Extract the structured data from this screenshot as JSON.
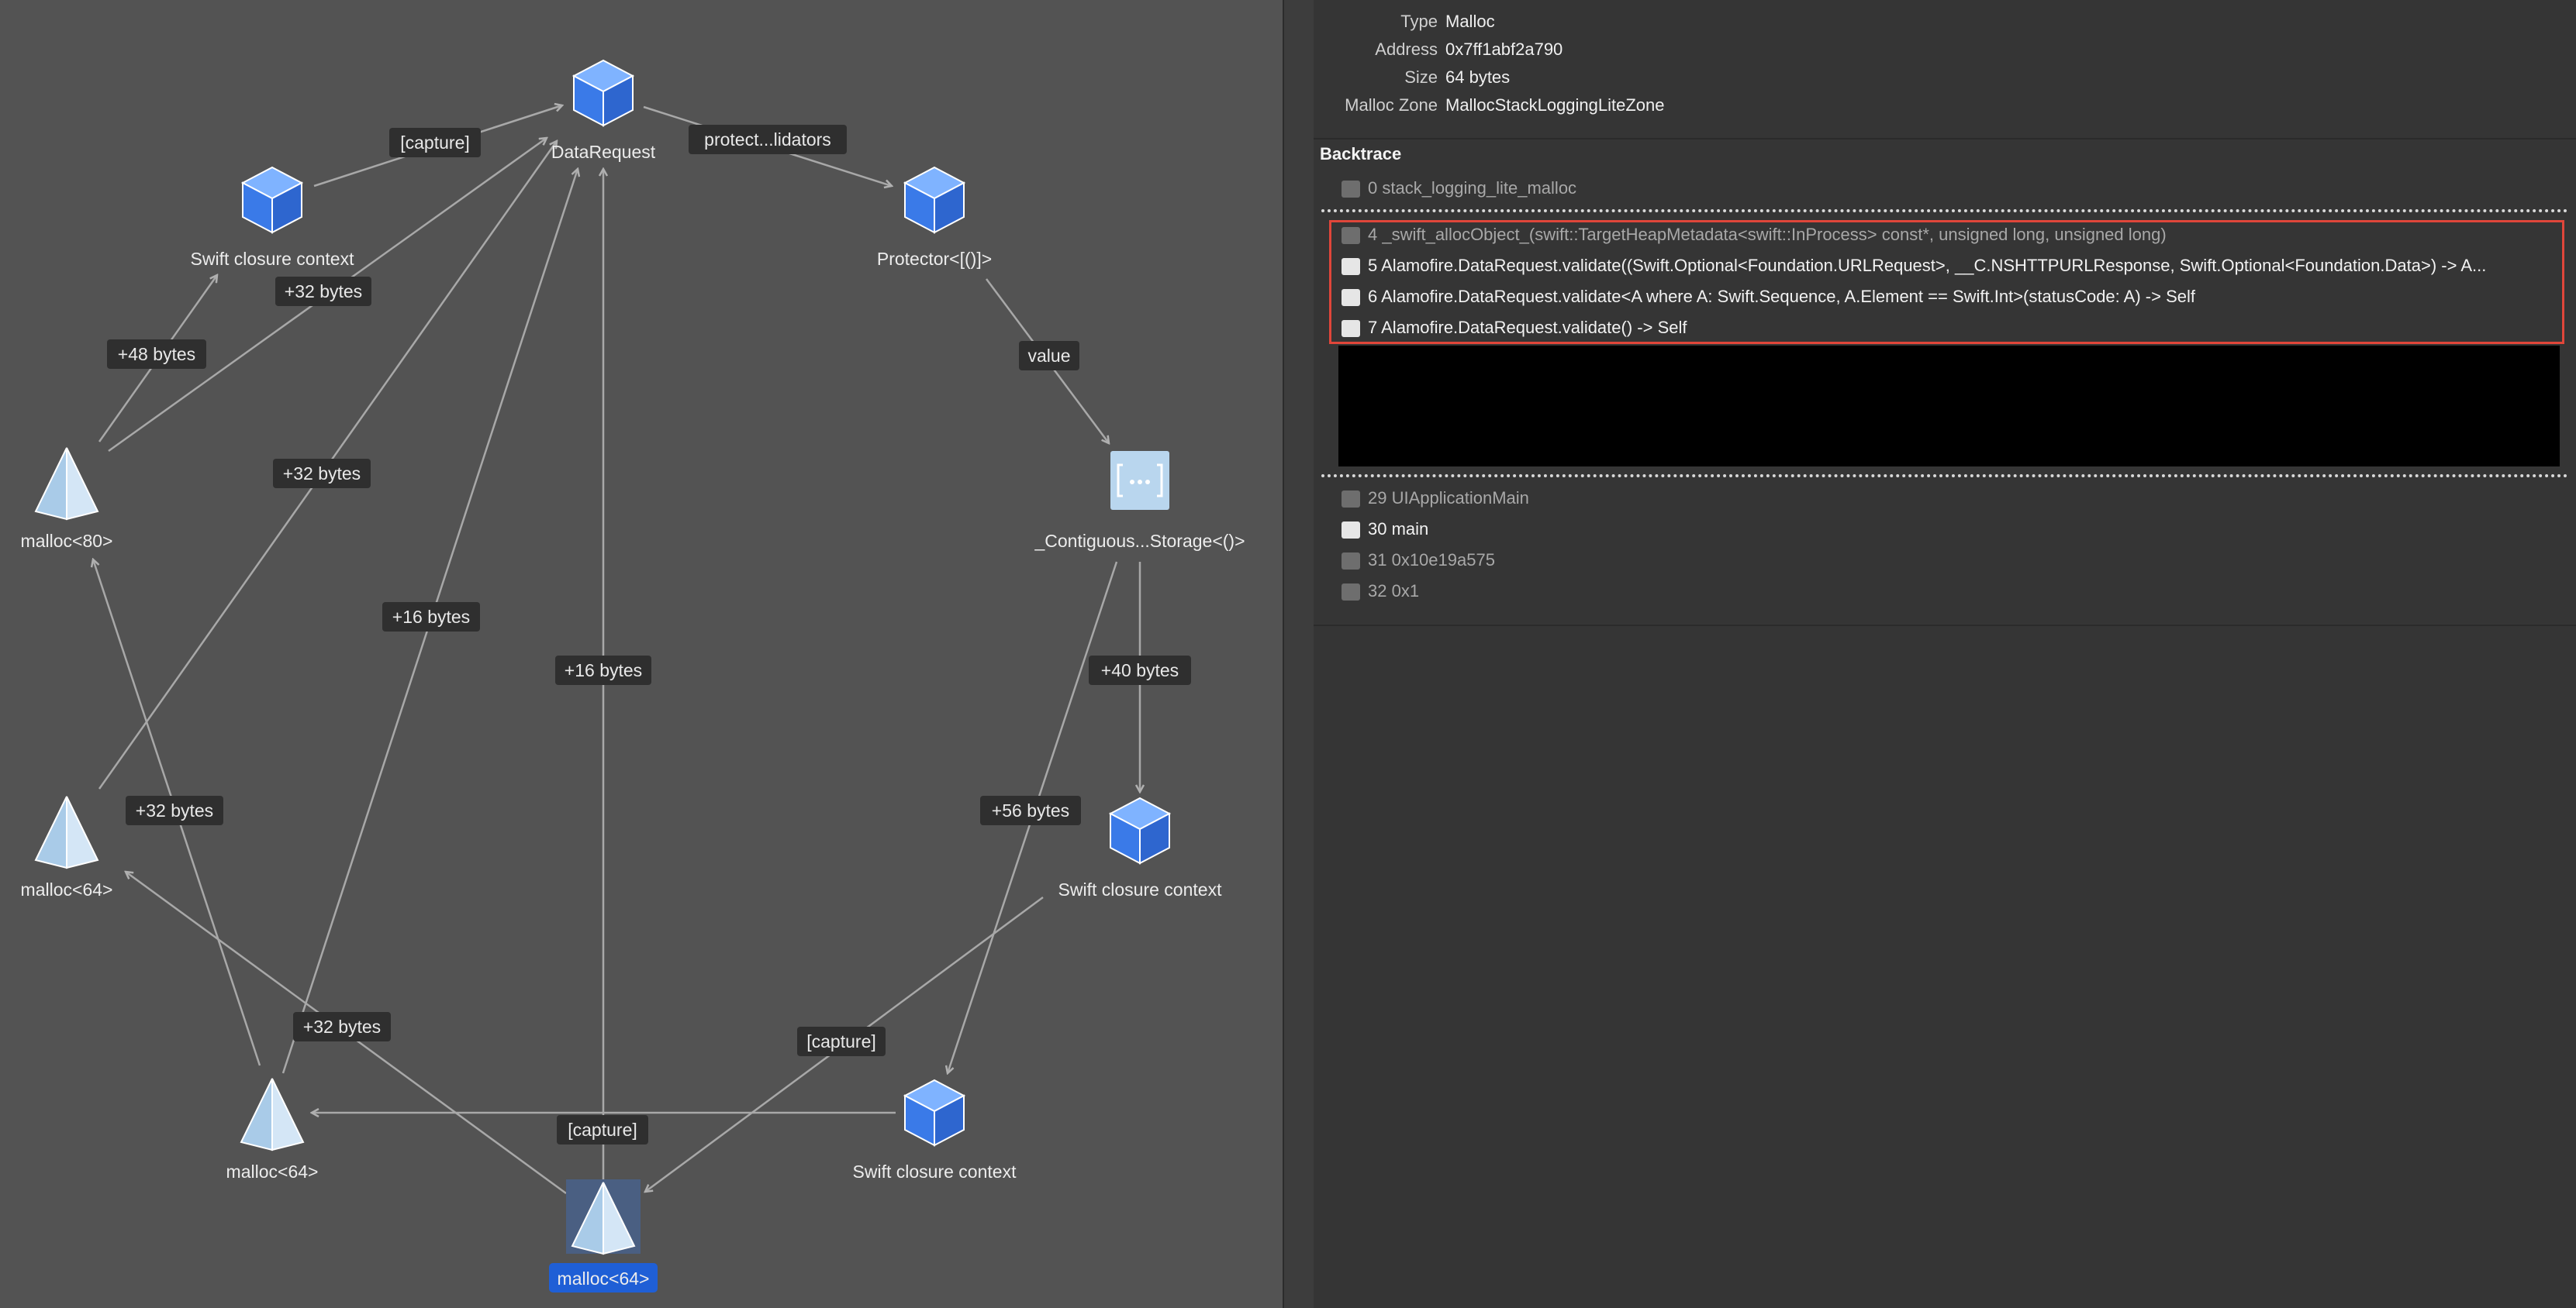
{
  "graph": {
    "nodes": [
      {
        "id": "dr",
        "label": "DataRequest",
        "shape": "cube"
      },
      {
        "id": "scc1",
        "label": "Swift closure context",
        "shape": "cube"
      },
      {
        "id": "prot",
        "label": "Protector<[()]>",
        "shape": "cube"
      },
      {
        "id": "m80",
        "label": "malloc<80>",
        "shape": "pyramid"
      },
      {
        "id": "cont",
        "label": "_Contiguous...Storage<()>",
        "shape": "ellipsis"
      },
      {
        "id": "m64a",
        "label": "malloc<64>",
        "shape": "pyramid"
      },
      {
        "id": "scc2",
        "label": "Swift closure context",
        "shape": "cube"
      },
      {
        "id": "m64b",
        "label": "malloc<64>",
        "shape": "pyramid"
      },
      {
        "id": "scc3",
        "label": "Swift closure context",
        "shape": "cube"
      },
      {
        "id": "m64sel",
        "label": "malloc<64>",
        "shape": "pyramid",
        "selected": true
      }
    ],
    "edge_labels": {
      "capture1": "[capture]",
      "protect": "protect...lidators",
      "b32a": "+32 bytes",
      "b48": "+48 bytes",
      "value": "value",
      "b32b": "+32 bytes",
      "b16a": "+16 bytes",
      "b16b": "+16 bytes",
      "b40": "+40 bytes",
      "b32c": "+32 bytes",
      "b56": "+56 bytes",
      "b32d": "+32 bytes",
      "capture2": "[capture]",
      "capture3": "[capture]"
    },
    "colors": {
      "cube": "#3b82f0",
      "pyramid": "#b9d6ee",
      "selected": "#1f5fd6",
      "edge": "#a8a8a8"
    }
  },
  "details": {
    "rows": [
      {
        "key": "Type",
        "value": "Malloc"
      },
      {
        "key": "Address",
        "value": "0x7ff1abf2a790"
      },
      {
        "key": "Size",
        "value": "64 bytes"
      },
      {
        "key": "Malloc Zone",
        "value": "MallocStackLoggingLiteZone"
      }
    ]
  },
  "backtrace": {
    "title": "Backtrace",
    "frames_top": [
      {
        "text": "0 stack_logging_lite_malloc",
        "icon": "gear-icon",
        "dim": true
      }
    ],
    "frames_highlighted": [
      {
        "text": "4 _swift_allocObject_(swift::TargetHeapMetadata<swift::InProcess> const*, unsigned long, unsigned long)",
        "icon": "play-frame-icon",
        "dim": true
      },
      {
        "text": "5 Alamofire.DataRequest.validate((Swift.Optional<Foundation.URLRequest>, __C.NSHTTPURLResponse, Swift.Optional<Foundation.Data>) -> A...",
        "icon": "user-icon",
        "dim": false
      },
      {
        "text": "6 Alamofire.DataRequest.validate<A where A: Swift.Sequence, A.Element == Swift.Int>(statusCode: A) -> Self",
        "icon": "user-icon",
        "dim": false
      },
      {
        "text": "7 Alamofire.DataRequest.validate() -> Self",
        "icon": "user-icon",
        "dim": false
      }
    ],
    "frames_bottom": [
      {
        "text": "29 UIApplicationMain",
        "icon": "briefcase-icon",
        "dim": true
      },
      {
        "text": "30 main",
        "icon": "user-icon",
        "dim": false
      },
      {
        "text": "31 0x10e19a575",
        "icon": "gear-icon",
        "dim": true
      },
      {
        "text": "32 0x1",
        "icon": "building-icon",
        "dim": true
      }
    ]
  }
}
